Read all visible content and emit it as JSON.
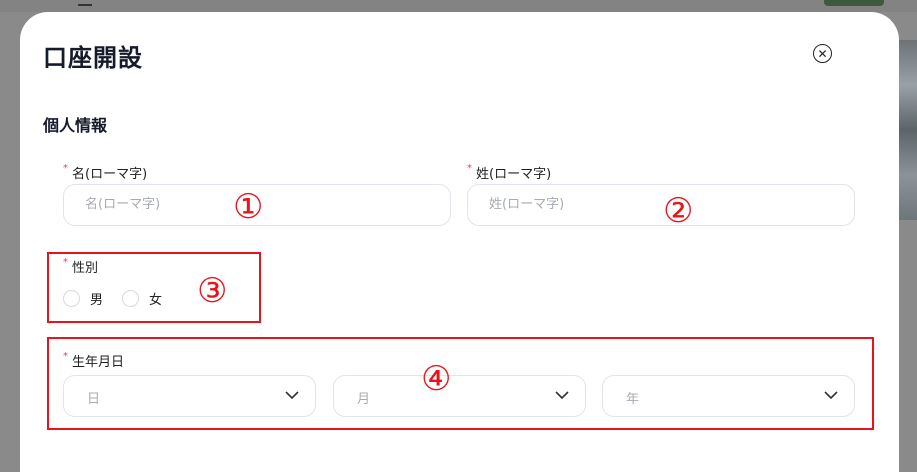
{
  "modal": {
    "title": "口座開設",
    "close_icon": "close-circle-icon",
    "section_title": "個人情報"
  },
  "fields": {
    "first_name": {
      "required": "*",
      "label": "名(ローマ字)",
      "placeholder": "名(ローマ字)",
      "value": ""
    },
    "last_name": {
      "required": "*",
      "label": "姓(ローマ字)",
      "placeholder": "姓(ローマ字)",
      "value": ""
    },
    "gender": {
      "required": "*",
      "label": "性別",
      "options": [
        "男",
        "女"
      ]
    },
    "birthday": {
      "required": "*",
      "label": "生年月日",
      "day": "日",
      "month": "月",
      "year": "年"
    }
  },
  "annotations": {
    "marker_1": "①",
    "marker_2": "②",
    "marker_3": "③",
    "marker_4": "④",
    "color": "#e8141b"
  },
  "colors": {
    "required": "#e0424a",
    "border": "#e1e4ea",
    "placeholder": "#a7abb3"
  }
}
